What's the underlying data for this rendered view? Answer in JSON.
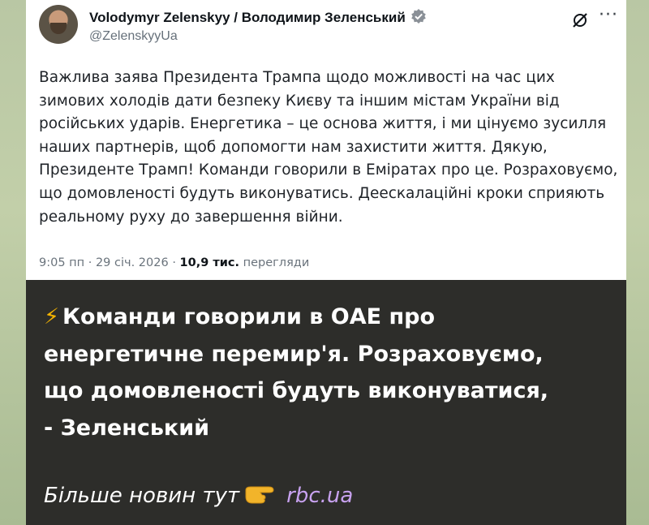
{
  "tweet": {
    "author_name": "Volodymyr Zelenskyy / Володимир Зеленський",
    "author_handle": "@ZelenskyyUa",
    "lines": [
      "Важлива заява Президента Трампа щодо можливості на час цих",
      "зимових холодів дати безпеку Києву та іншим містам України від",
      "російських ударів. Енергетика – це основа життя, і ми цінуємо зусилля",
      "наших партнерів, щоб допомогти нам захистити життя. Дякую,",
      "Президенте Трамп! Команди говорили в Еміратах про це. Розраховуємо,",
      "що домовленості будуть виконуватись. Деескалаційні кроки сприяють",
      "реальному руху до завершення війни."
    ],
    "timestamp": "9:05 пп · 29 січ. 2026 ·",
    "views_count": "10,9 тис.",
    "views_label": "перегляди"
  },
  "caption": {
    "lines": [
      "Команди говорили в ОАЕ про",
      "енергетичне перемир'я. Розраховуємо,",
      "що домовленості будуть виконуватися,",
      "- Зеленський"
    ],
    "bolt": "⚡"
  },
  "footer": {
    "text": "Більше новин тут",
    "link": "rbc.ua"
  },
  "icons": [
    "verified-badge-icon",
    "grok-icon",
    "more-icon",
    "bolt-icon",
    "pointing-hand-icon"
  ],
  "colors": {
    "message_bg": "#2d2d2a",
    "link": "#c8a2f0",
    "bolt": "#f5b400"
  }
}
